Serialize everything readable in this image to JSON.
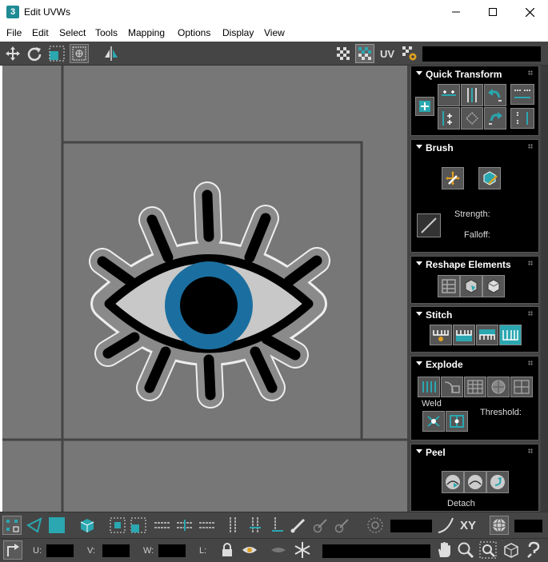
{
  "window": {
    "app_icon_text": "3",
    "title": "Edit UVWs"
  },
  "menu": [
    "File",
    "Edit",
    "Select",
    "Tools",
    "Mapping",
    "Options",
    "Display",
    "View"
  ],
  "toolbar": {
    "uv_label": "UV"
  },
  "rollouts": {
    "quick_transform": {
      "title": "Quick Transform"
    },
    "brush": {
      "title": "Brush",
      "strength_label": "Strength:",
      "falloff_label": "Falloff:"
    },
    "reshape": {
      "title": "Reshape Elements"
    },
    "stitch": {
      "title": "Stitch"
    },
    "explode": {
      "title": "Explode",
      "weld_label": "Weld",
      "threshold_label": "Threshold:"
    },
    "peel": {
      "title": "Peel",
      "detach_label": "Detach"
    }
  },
  "bottom": {
    "xy_label": "XY",
    "u_label": "U:",
    "v_label": "V:",
    "w_label": "W:",
    "l_label": "L:"
  },
  "colors": {
    "accent": "#2aa7b0",
    "iris": "#1b6fa0",
    "viewport": "#777777",
    "panel_bg": "#000000"
  }
}
